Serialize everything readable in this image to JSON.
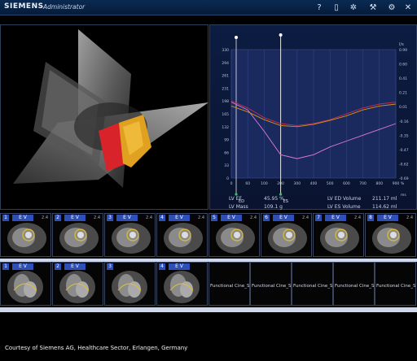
{
  "app": {
    "brand": "SIEMENS",
    "role": "Administrator",
    "toolbar_icons": [
      "help-icon",
      "document-icon",
      "gear-icon",
      "tool-icon",
      "wrench-icon",
      "close-icon"
    ]
  },
  "chart": {
    "left_ticks": [
      "330",
      "294",
      "261",
      "231",
      "198",
      "165",
      "132",
      "99",
      "66",
      "33",
      "0"
    ],
    "right_ticks": [
      "0.99",
      "0.60",
      "0.41",
      "0.21",
      "0.01",
      "-0.16",
      "-0.35",
      "-0.47",
      "-0.62",
      "-0.69"
    ],
    "right_unit": "l/s",
    "x_ticks": [
      "0",
      "60",
      "100",
      "200",
      "300",
      "400",
      "500",
      "600",
      "700",
      "800",
      "900"
    ],
    "x_unit_pct": "%",
    "x_unit_ms": "ms",
    "top_right_label": "l/s",
    "marker_ed": "ED",
    "marker_es": "ES"
  },
  "chart_data": {
    "type": "line",
    "x": [
      0,
      10,
      20,
      30,
      40,
      50,
      60,
      70,
      80,
      90,
      100
    ],
    "series": [
      {
        "values": [
          195,
          175,
          120,
          60,
          50,
          60,
          80,
          95,
          110,
          125,
          140
        ],
        "color": "#e07ad0"
      },
      {
        "values": [
          198,
          180,
          155,
          140,
          135,
          140,
          150,
          165,
          180,
          190,
          195
        ],
        "color": "#c03050"
      },
      {
        "values": [
          185,
          170,
          150,
          135,
          132,
          138,
          148,
          160,
          175,
          185,
          190
        ],
        "color": "#d89020"
      }
    ]
  },
  "stats": {
    "lv_ef_label": "LV EF",
    "lv_ef_value": "45.95 %",
    "lv_mass_label": "LV Mass",
    "lv_mass_value": "109.1 g",
    "lv_ed_label": "LV ED Volume",
    "lv_ed_value": "211.17 ml",
    "lv_es_label": "LV ES Volume",
    "lv_es_value": "114.62 ml"
  },
  "strip1": {
    "thumbs": [
      {
        "num": "1",
        "tag": "E V",
        "scale": "2.4"
      },
      {
        "num": "2",
        "tag": "E V",
        "scale": "2.4"
      },
      {
        "num": "3",
        "tag": "E V",
        "scale": "2.4"
      },
      {
        "num": "4",
        "tag": "E V",
        "scale": "2.4"
      },
      {
        "num": "5",
        "tag": "E V",
        "scale": "2.4"
      },
      {
        "num": "6",
        "tag": "E V",
        "scale": "2.4"
      },
      {
        "num": "7",
        "tag": "E V",
        "scale": "2.4"
      },
      {
        "num": "8",
        "tag": "E V",
        "scale": "2.4"
      }
    ]
  },
  "strip2": {
    "thumbs": [
      {
        "num": "1",
        "tag": "E V"
      },
      {
        "num": "2",
        "tag": "E V"
      },
      {
        "num": "3",
        "tag": ""
      },
      {
        "num": "4",
        "tag": "E V"
      }
    ],
    "series_label": "Functional Cine_Segmented LV",
    "series_count": 5
  },
  "footer": "Courtesy of Siemens AG, Healthcare Sector, Erlangen, Germany"
}
